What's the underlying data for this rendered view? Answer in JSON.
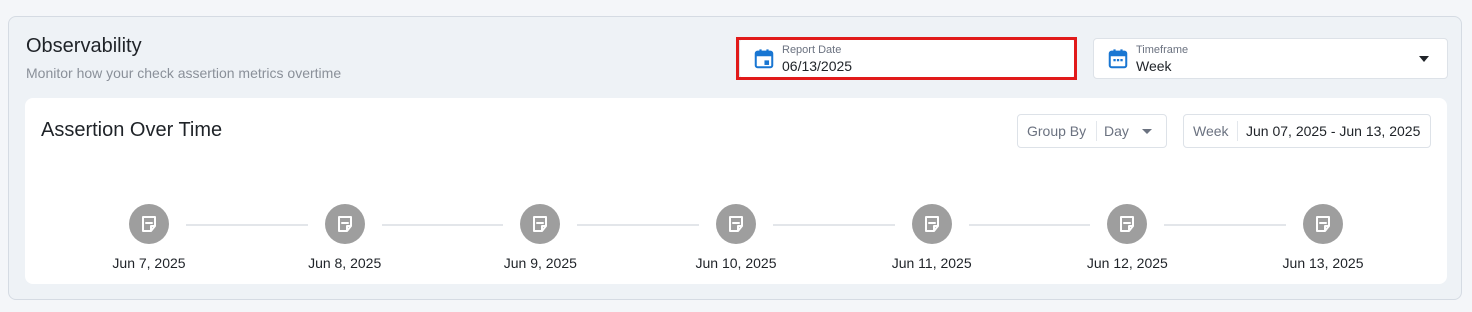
{
  "header": {
    "title": "Observability",
    "subtitle": "Monitor how your check assertion metrics overtime"
  },
  "report_date": {
    "label": "Report Date",
    "value": "06/13/2025",
    "icon": "calendar-icon"
  },
  "timeframe": {
    "label": "Timeframe",
    "value": "Week",
    "icon": "calendar-icon"
  },
  "colors": {
    "accent": "#1976d2",
    "highlight_outline": "#e11a1a",
    "node_fill": "#9e9e9e"
  },
  "card": {
    "title": "Assertion Over Time",
    "group_by": {
      "label": "Group By",
      "value": "Day"
    },
    "week": {
      "label": "Week",
      "value": "Jun 07, 2025 - Jun 13, 2025"
    }
  },
  "timeline": {
    "icon": "note-icon",
    "days": [
      {
        "label": "Jun 7, 2025"
      },
      {
        "label": "Jun 8, 2025"
      },
      {
        "label": "Jun 9, 2025"
      },
      {
        "label": "Jun 10, 2025"
      },
      {
        "label": "Jun 11, 2025"
      },
      {
        "label": "Jun 12, 2025"
      },
      {
        "label": "Jun 13, 2025"
      }
    ]
  }
}
